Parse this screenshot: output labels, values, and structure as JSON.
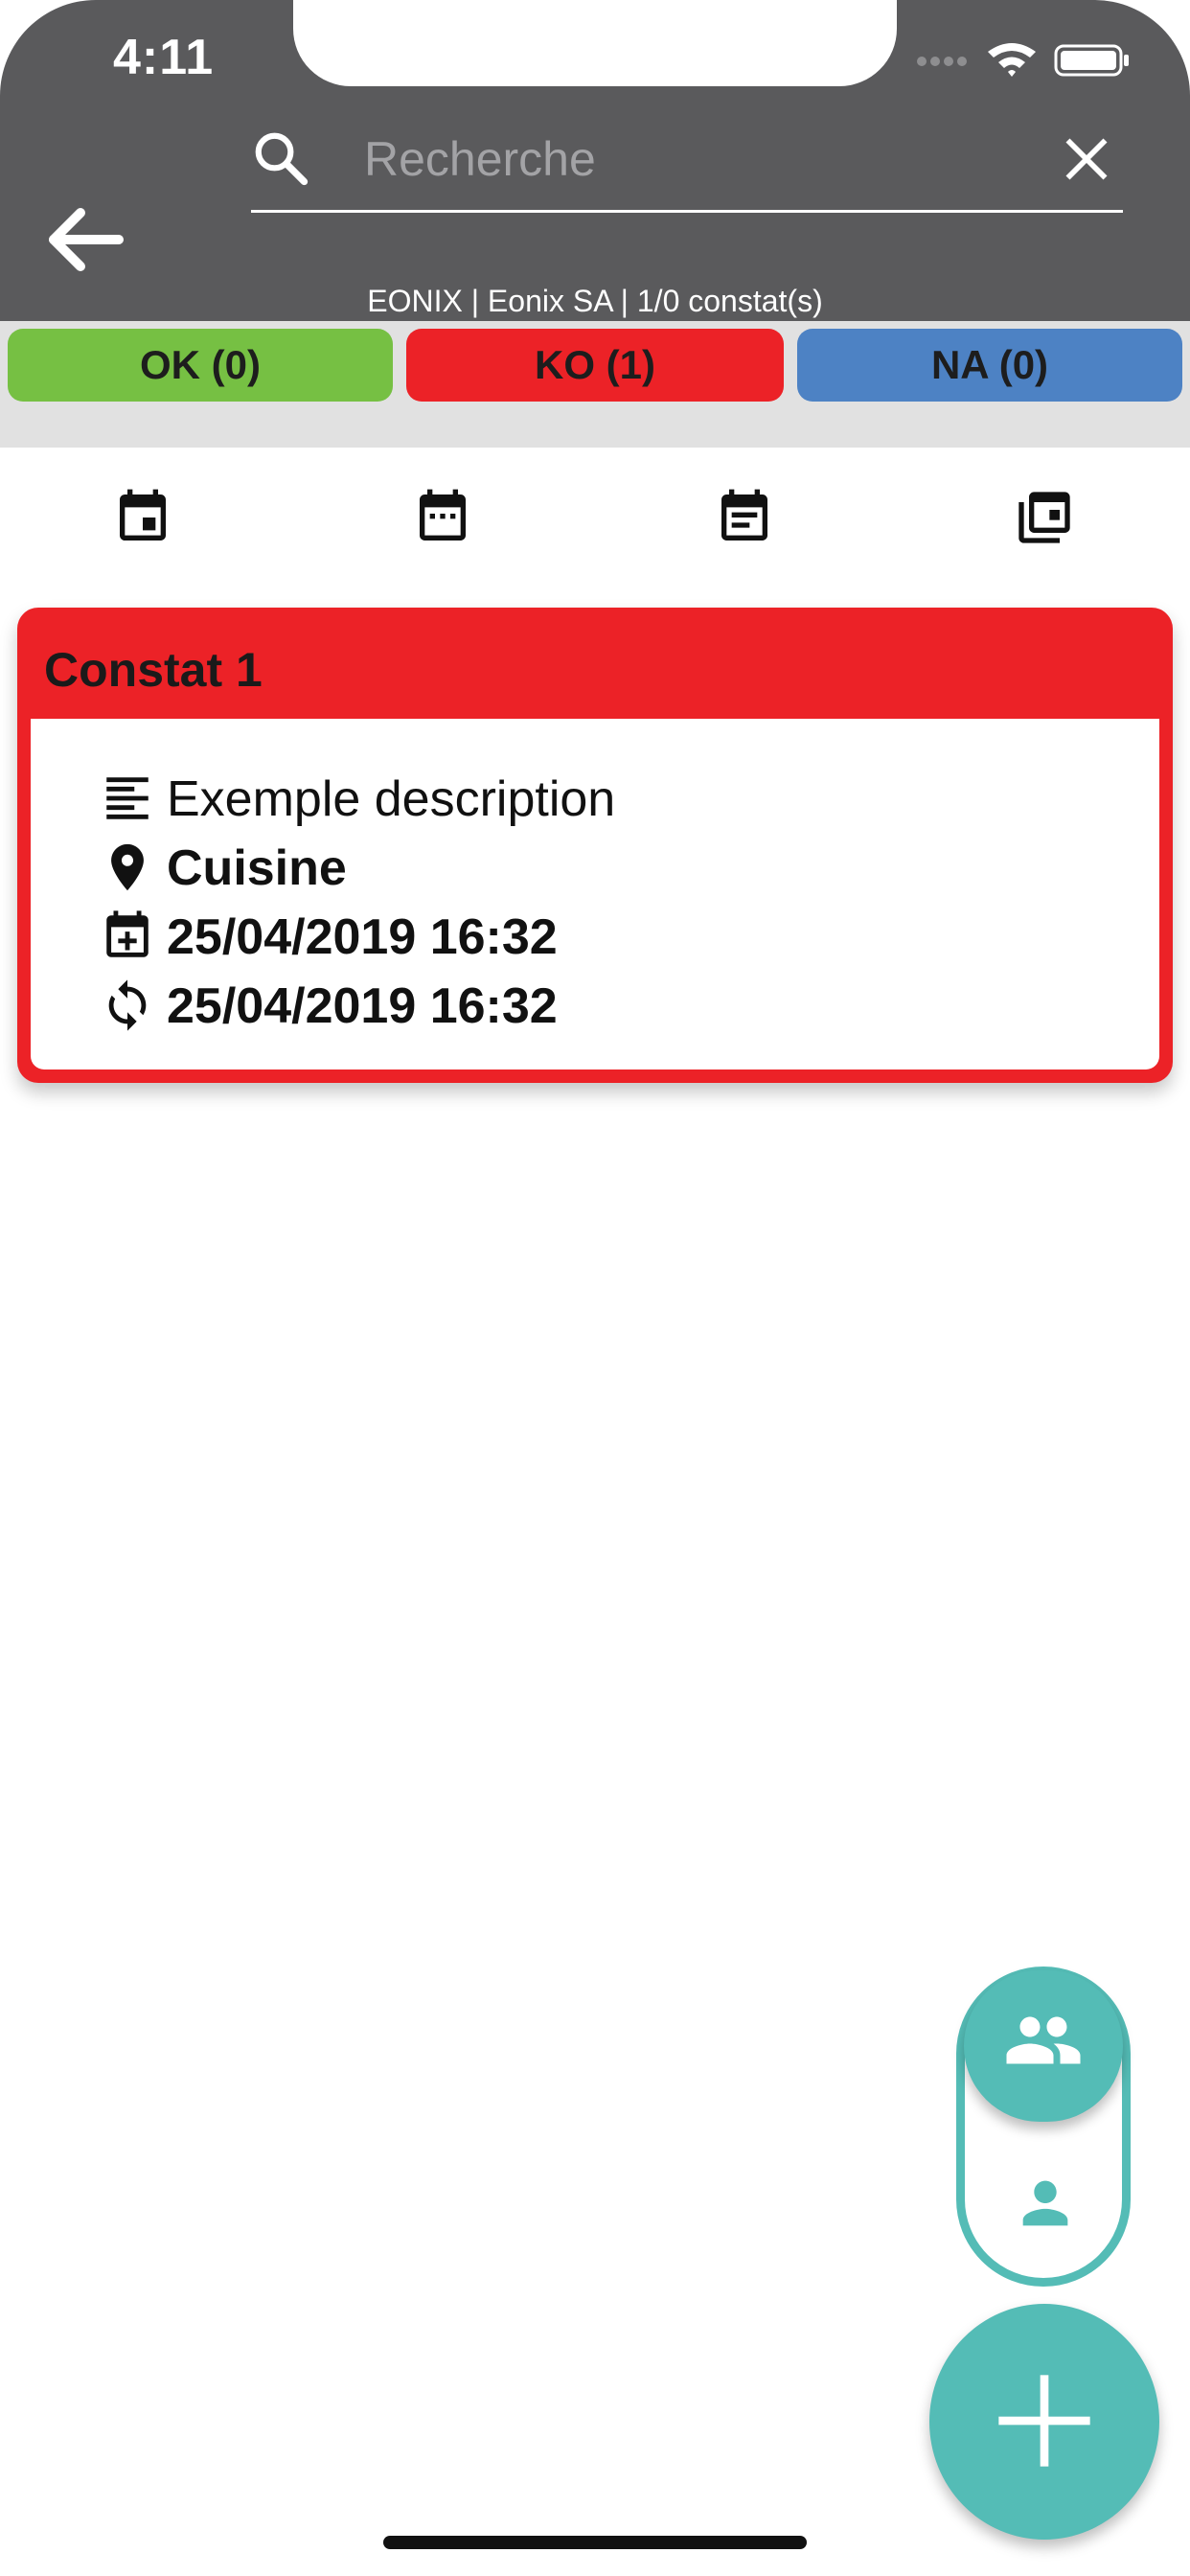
{
  "status_bar": {
    "time": "4:11"
  },
  "search": {
    "placeholder": "Recherche",
    "value": ""
  },
  "header": {
    "subtitle": "EONIX | Eonix SA | 1/0 constat(s)"
  },
  "filters": [
    {
      "label": "OK (0)",
      "color": "#76c043"
    },
    {
      "label": "KO (1)",
      "color": "#ec2227"
    },
    {
      "label": "NA (0)",
      "color": "#4d82c4"
    }
  ],
  "sort_icons": [
    "calendar-event-icon",
    "calendar-today-icon",
    "calendar-note-icon",
    "library-icon"
  ],
  "card": {
    "title": "Constat 1",
    "description": "Exemple description",
    "location": "Cuisine",
    "created": "25/04/2019 16:32",
    "updated": "25/04/2019 16:32",
    "status_color": "#ec2227"
  },
  "colors": {
    "header": "#5a5a5c",
    "accent": "#54bcb6"
  }
}
